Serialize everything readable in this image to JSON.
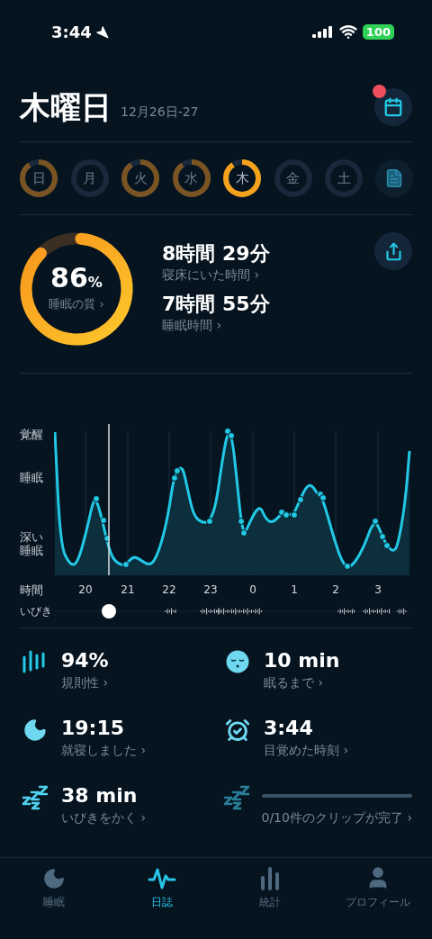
{
  "status_bar": {
    "time": "3:44",
    "battery": "100"
  },
  "header": {
    "title": "木曜日",
    "date": "12月26日-27",
    "calendar_badge": true
  },
  "days": [
    {
      "label": "日",
      "recorded": true,
      "selected": false
    },
    {
      "label": "月",
      "recorded": false,
      "selected": false
    },
    {
      "label": "火",
      "recorded": true,
      "selected": false
    },
    {
      "label": "水",
      "recorded": true,
      "selected": false
    },
    {
      "label": "木",
      "recorded": true,
      "selected": true
    },
    {
      "label": "金",
      "recorded": false,
      "selected": false
    },
    {
      "label": "土",
      "recorded": false,
      "selected": false
    }
  ],
  "summary": {
    "quality": {
      "value": "86",
      "unit": "%",
      "label": "睡眠の質 ›"
    },
    "durations": [
      {
        "value": "8時間 29分",
        "label": "寝床にいた時間 ›"
      },
      {
        "value": "7時間 55分",
        "label": "睡眠時間 ›"
      }
    ]
  },
  "sleep_graph": {
    "stage_labels": [
      "覚醒",
      "睡眠",
      "深い睡眠"
    ],
    "time_label": "時間",
    "hours": [
      "20",
      "21",
      "22",
      "23",
      "0",
      "1",
      "2",
      "3"
    ],
    "snore_label": "いびき"
  },
  "stats": [
    {
      "kind": "value",
      "value": "94%",
      "label": "規則性 ›"
    },
    {
      "kind": "value",
      "value": "10 min",
      "label": "眠るまで ›"
    },
    {
      "kind": "value",
      "value": "19:15",
      "label": "就寝しました ›"
    },
    {
      "kind": "value",
      "value": "3:44",
      "label": "目覚めた時刻 ›"
    },
    {
      "kind": "value",
      "value": "38 min",
      "label": "いびきをかく ›"
    },
    {
      "kind": "progress",
      "label": "0/10件のクリップが完了 ›"
    }
  ],
  "tabs": [
    {
      "label": "睡眠",
      "selected": false
    },
    {
      "label": "日誌",
      "selected": true
    },
    {
      "label": "統計",
      "selected": false
    },
    {
      "label": "プロフィール",
      "selected": false
    }
  ]
}
